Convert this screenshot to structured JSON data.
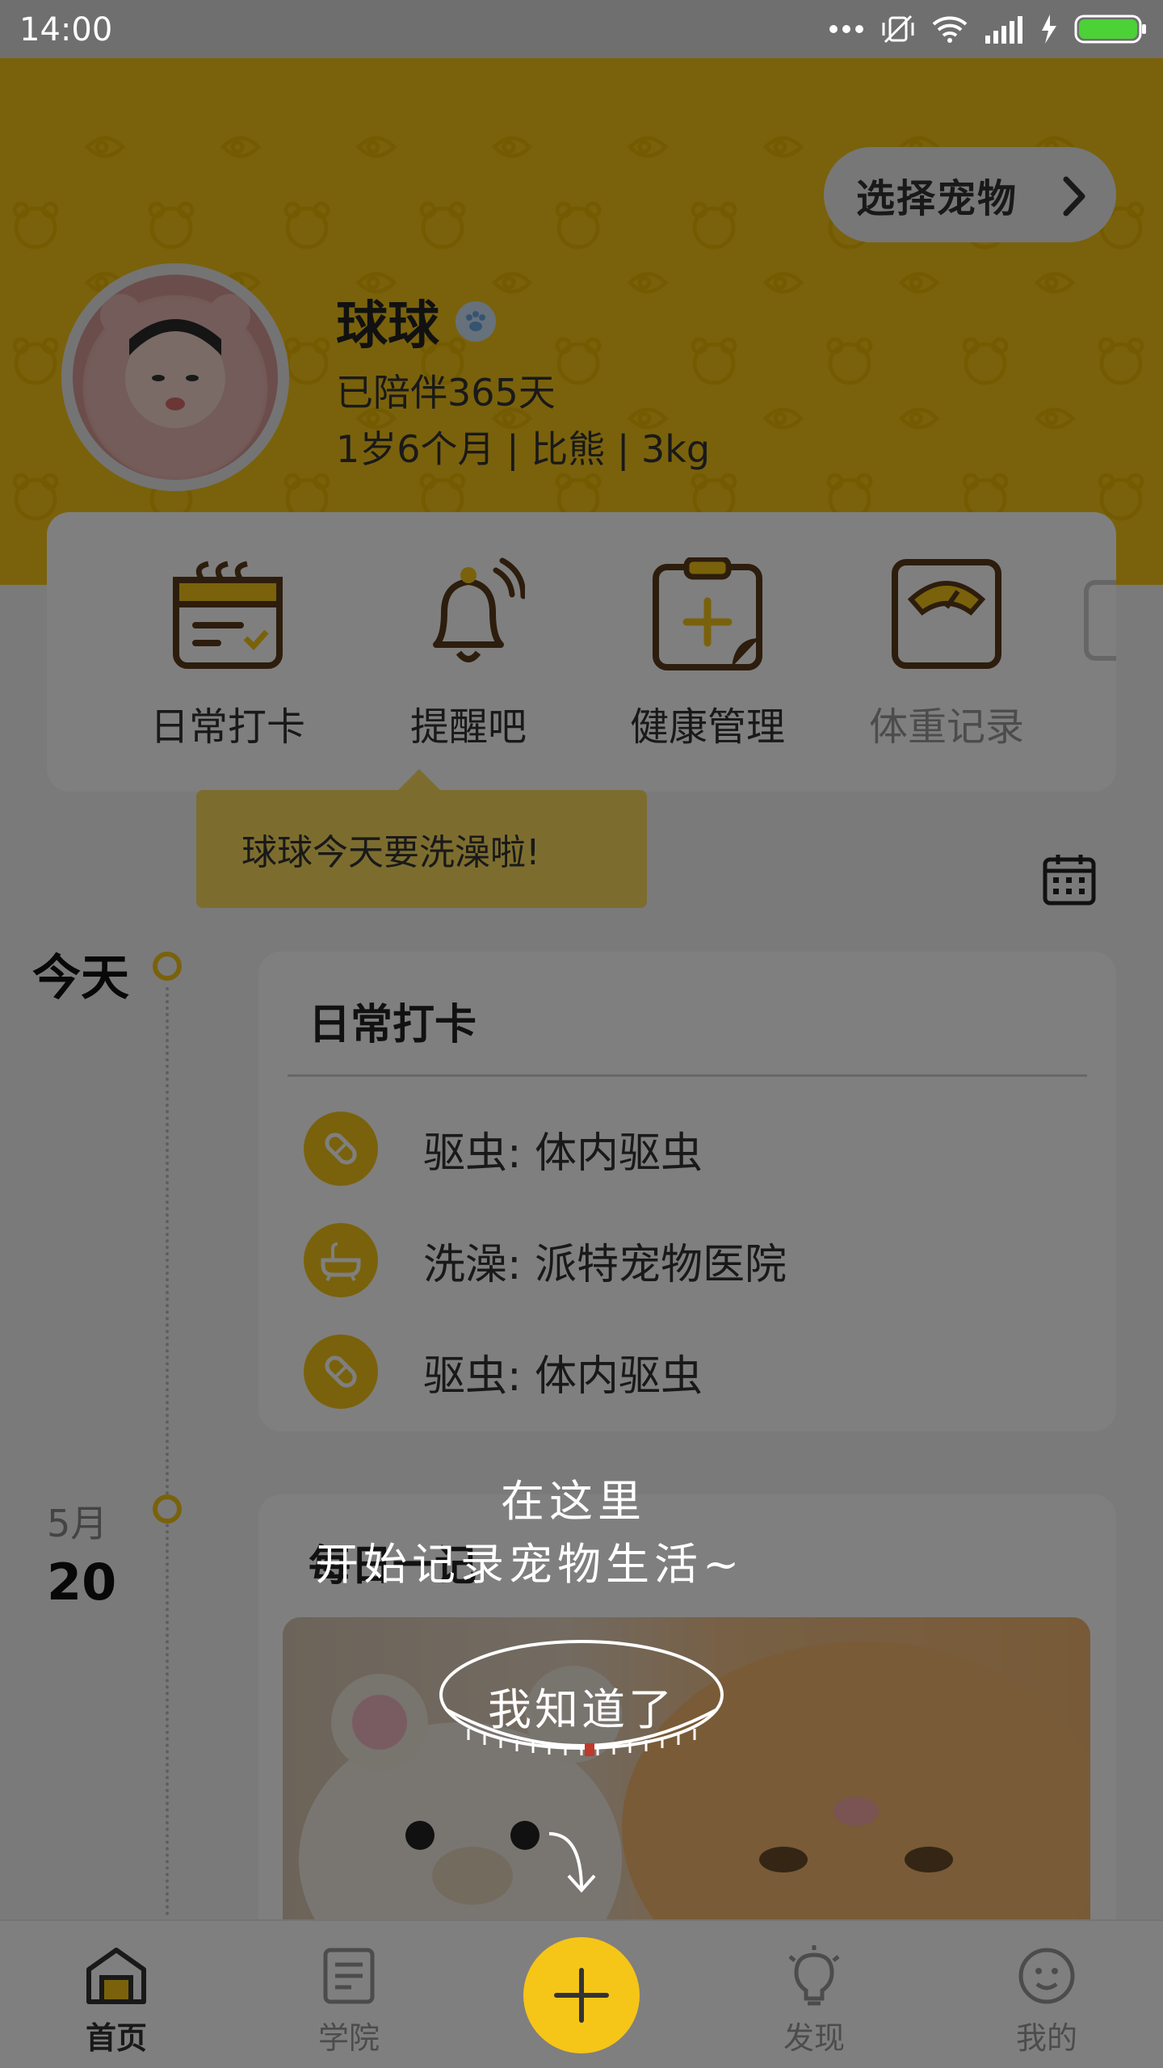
{
  "status_bar": {
    "time": "14:00"
  },
  "header": {
    "select_pet_label": "选择宠物",
    "pet_name": "球球",
    "days_label": "已陪伴365天",
    "info": "1岁6个月 | 比熊 | 3kg"
  },
  "quick_actions": [
    {
      "label": "日常打卡",
      "icon": "calendar-check-icon"
    },
    {
      "label": "提醒吧",
      "icon": "bell-icon"
    },
    {
      "label": "健康管理",
      "icon": "medical-clipboard-icon"
    },
    {
      "label": "体重记录",
      "icon": "scale-icon"
    }
  ],
  "tooltip": {
    "text": "球球今天要洗澡啦!"
  },
  "timeline": {
    "today_label": "今天",
    "daily_card": {
      "title": "日常打卡",
      "rows": [
        {
          "icon": "pill-icon",
          "text": "驱虫:  体内驱虫"
        },
        {
          "icon": "bathtub-icon",
          "text": "洗澡:  派特宠物医院"
        },
        {
          "icon": "pill-icon",
          "text": "驱虫:  体内驱虫"
        }
      ]
    },
    "second_date": {
      "month": "5月",
      "day": "20"
    },
    "post_card": {
      "title": "每日一记"
    }
  },
  "guide_overlay": {
    "line1": "在这里",
    "line2": "开始记录宠物生活~",
    "button": "我知道了"
  },
  "bottom_nav": [
    {
      "label": "首页",
      "icon": "home-icon",
      "active": true
    },
    {
      "label": "学院",
      "icon": "book-icon",
      "active": false
    },
    {
      "label": "",
      "icon": "plus-icon",
      "active": false
    },
    {
      "label": "发现",
      "icon": "lightbulb-icon",
      "active": false
    },
    {
      "label": "我的",
      "icon": "smile-face-icon",
      "active": false
    }
  ],
  "colors": {
    "accent": "#f5c518",
    "icon_brown": "#5a3a1a"
  }
}
